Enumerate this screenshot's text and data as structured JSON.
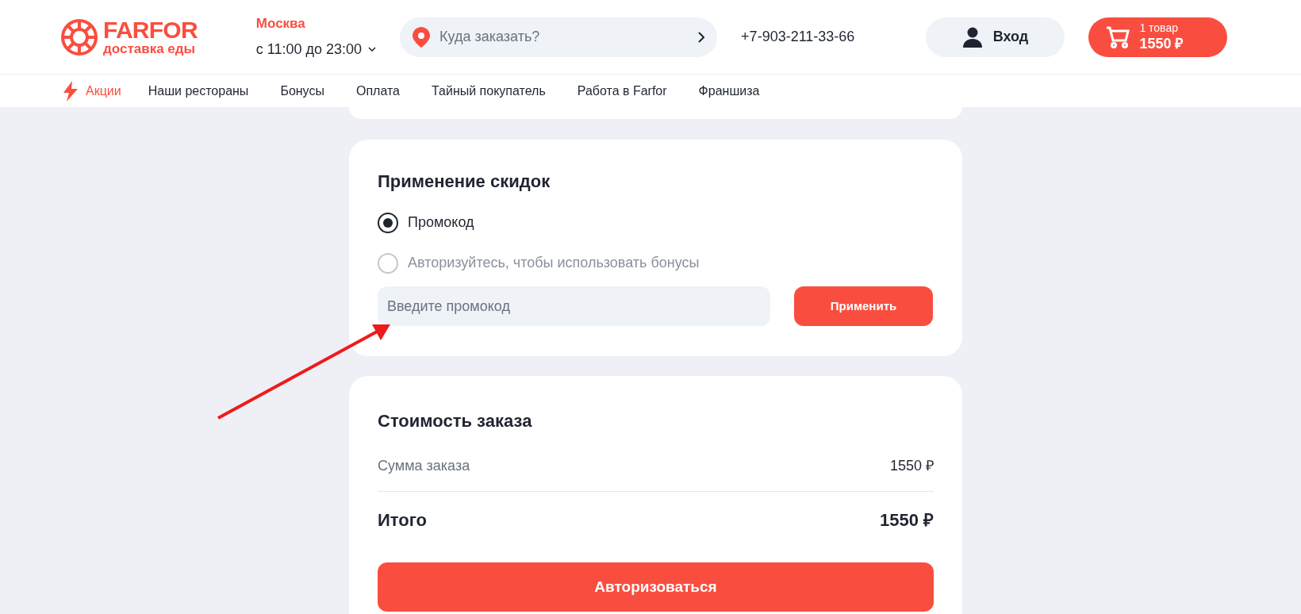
{
  "logo": {
    "name": "FARFOR",
    "tagline": "доставка еды"
  },
  "city": {
    "name": "Москва",
    "hours": "с 11:00 до 23:00"
  },
  "address_search": {
    "placeholder": "Куда заказать?"
  },
  "phone": "+7-903-211-33-66",
  "login_button": "Вход",
  "cart": {
    "count": "1 товар",
    "total": "1550 ₽"
  },
  "nav": [
    {
      "label": "Акции",
      "kind": "promo"
    },
    {
      "label": "Наши рестораны",
      "kind": "link"
    },
    {
      "label": "Бонусы",
      "kind": "link"
    },
    {
      "label": "Оплата",
      "kind": "link"
    },
    {
      "label": "Тайный покупатель",
      "kind": "link"
    },
    {
      "label": "Работа в Farfor",
      "kind": "link"
    },
    {
      "label": "Франшиза",
      "kind": "link"
    }
  ],
  "discounts": {
    "title": "Применение скидок",
    "options": [
      {
        "label": "Промокод",
        "selected": true,
        "disabled": false
      },
      {
        "label": "Авторизуйтесь, чтобы использовать бонусы",
        "selected": false,
        "disabled": true
      }
    ],
    "promo_field": {
      "placeholder": "Введите промокод"
    },
    "apply_button": "Применить"
  },
  "order_cost": {
    "title": "Стоимость заказа",
    "rows": [
      {
        "label": "Сумма заказа",
        "value": "1550 ₽",
        "kind": "subtotal"
      },
      {
        "label": "Итого",
        "value": "1550 ₽",
        "kind": "total"
      }
    ],
    "button": "Авторизоваться"
  }
}
